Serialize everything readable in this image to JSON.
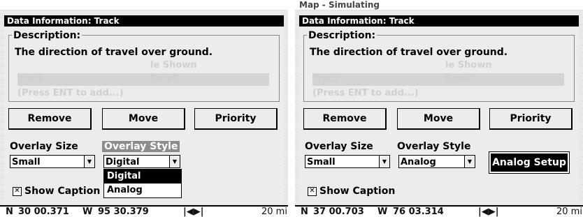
{
  "left": {
    "bg_title": "",
    "dialog_title": "Data Information: Track",
    "description_label": "Description:",
    "description_text": "The direction of travel over ground.",
    "ghost_rows": [
      {
        "name": "",
        "value": "le Shown"
      },
      {
        "name": "Track",
        "value": "Small"
      },
      {
        "name": "(Press ENT to add...)",
        "value": ""
      }
    ],
    "buttons": {
      "remove": "Remove",
      "move": "Move",
      "priority": "Priority"
    },
    "overlay_size_label": "Overlay Size",
    "overlay_style_label": "Overlay Style",
    "overlay_size_value": "Small",
    "overlay_style_value": "Digital",
    "dropdown_options": [
      "Digital",
      "Analog"
    ],
    "show_caption_label": "Show Caption",
    "status": {
      "lat_prefix": "N",
      "lat": "30 00.371",
      "lon_prefix": "W",
      "lon": "95 30.379",
      "scale": "20 mi"
    }
  },
  "right": {
    "bg_title": "Map - Simulating",
    "dialog_title": "Data Information: Track",
    "description_label": "Description:",
    "description_text": "The direction of travel over ground.",
    "ghost_rows": [
      {
        "name": "",
        "value": "le Shown"
      },
      {
        "name": "Track",
        "value": "Small"
      },
      {
        "name": "(Press ENT to add...)",
        "value": ""
      }
    ],
    "buttons": {
      "remove": "Remove",
      "move": "Move",
      "priority": "Priority"
    },
    "overlay_size_label": "Overlay Size",
    "overlay_style_label": "Overlay Style",
    "overlay_size_value": "Small",
    "overlay_style_value": "Analog",
    "analog_setup_label": "Analog Setup",
    "show_caption_label": "Show Caption",
    "status": {
      "lat_prefix": "N",
      "lat": "37 00.703",
      "lon_prefix": "W",
      "lon": "76 03.314",
      "scale": "20 mi"
    }
  },
  "colors": {
    "titlebar": "#000000",
    "highlight_label": "#8c8c8c",
    "selected_option": "#000000"
  }
}
